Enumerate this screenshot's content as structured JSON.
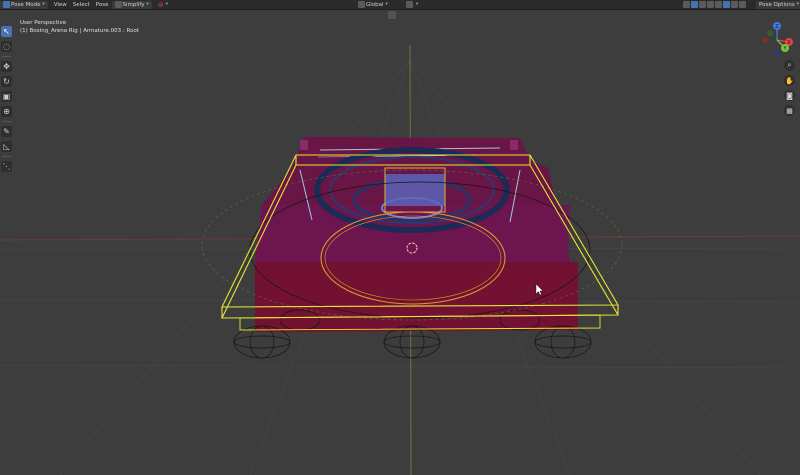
{
  "header": {
    "mode": "Pose Mode",
    "menus": [
      "View",
      "Select",
      "Pose"
    ],
    "simplify": "Simplify",
    "transform_orientation": "Global",
    "pose_options": "Pose Options"
  },
  "viewport": {
    "perspective": "User Perspective",
    "object_info": "(1) Boxing_Arena Rig | Armature.003 : Root"
  },
  "gizmo": {
    "x": "X",
    "y": "Y",
    "z": "Z"
  },
  "colors": {
    "viewport_bg": "#3d3d3d",
    "header_bg": "#2b2b2b",
    "accent": "#4772b3",
    "ring_mesh": "#6b1347",
    "selection_yellow": "#e6e632",
    "bone_orange": "#e09a2a",
    "axis_x": "#e8433f",
    "axis_y": "#7bc142",
    "axis_z": "#3f7ce0"
  },
  "icons": {
    "toolbar": [
      "cursor-icon",
      "select-circle-icon",
      "move-icon",
      "rotate-icon",
      "scale-icon",
      "transform-icon",
      "annotate-icon",
      "measure-icon",
      "relax-icon"
    ],
    "nav": [
      "zoom-icon",
      "pan-icon",
      "camera-icon",
      "grid-icon"
    ]
  }
}
